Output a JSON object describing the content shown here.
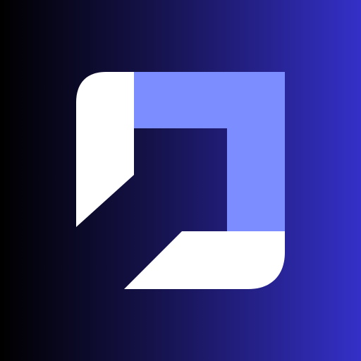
{
  "logo": {
    "icon": "abstract-square-bracket-logo-icon"
  },
  "colors": {
    "background_start": "#000000",
    "background_mid": "#15124a",
    "background_end": "#3430c8",
    "shape_white": "#ffffff",
    "shape_blue": "#7b8dff"
  }
}
